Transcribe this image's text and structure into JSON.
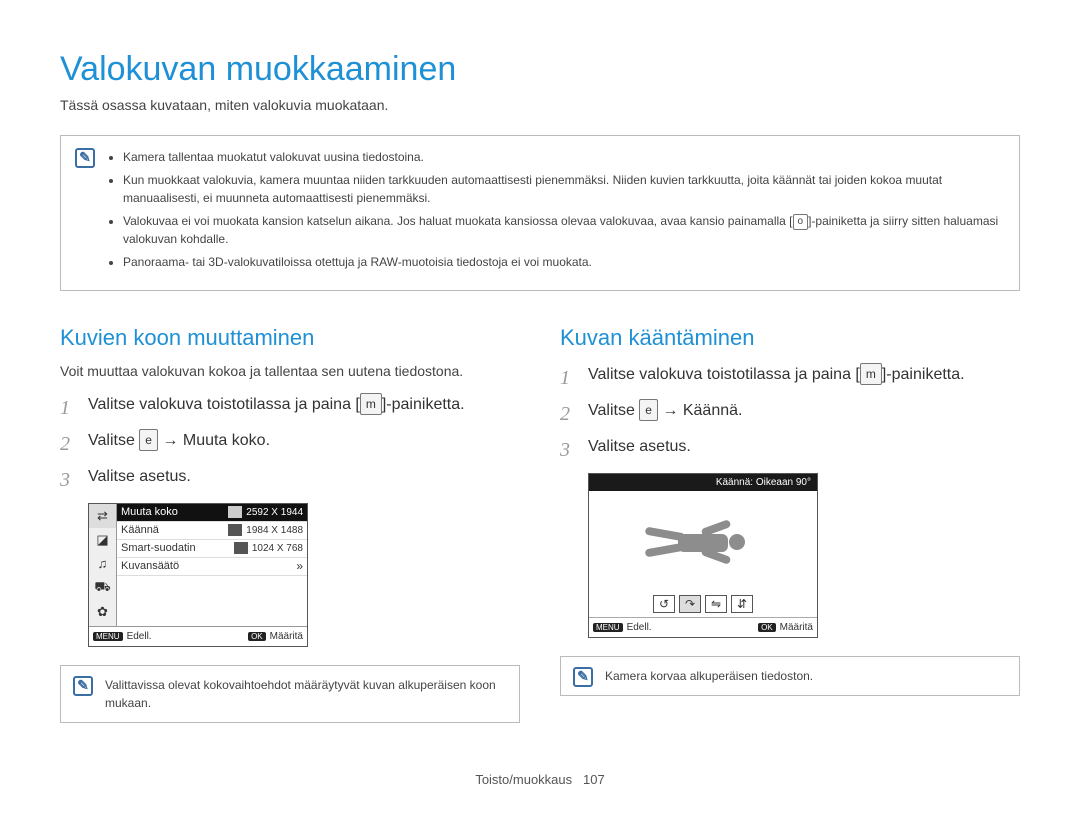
{
  "page": {
    "title": "Valokuvan muokkaaminen",
    "intro": "Tässä osassa kuvataan, miten valokuvia muokataan."
  },
  "top_info": {
    "bullets": [
      "Kamera tallentaa muokatut valokuvat uusina tiedostoina.",
      "Kun muokkaat valokuvia, kamera muuntaa niiden tarkkuuden automaattisesti pienemmäksi. Niiden kuvien tarkkuutta, joita käännät tai joiden kokoa muutat manuaalisesti, ei muunneta automaattisesti pienemmäksi.",
      "Valokuvaa ei voi muokata kansion katselun aikana. Jos haluat muokata kansiossa olevaa valokuvaa, avaa kansio painamalla [o]-painiketta ja siirry sitten haluamasi valokuvan kohdalle.",
      "Panoraama- tai 3D-valokuvatiloissa otettuja ja RAW-muotoisia tiedostoja ei voi muokata."
    ],
    "o_key": "o"
  },
  "left": {
    "title": "Kuvien koon muuttaminen",
    "desc": "Voit muuttaa valokuvan kokoa ja tallentaa sen uutena tiedostona.",
    "steps": [
      "Valitse valokuva toistotilassa ja paina [m]-painiketta.",
      "Valitse e → Muuta koko.",
      "Valitse asetus."
    ],
    "ui": {
      "menu_rows": [
        {
          "label": "Muuta koko",
          "value": "2592 X 1944",
          "black": true
        },
        {
          "label": "Käännä",
          "value": "1984 X 1488",
          "black": false
        },
        {
          "label": "Smart-suodatin",
          "value": "1024 X 768",
          "black": false
        },
        {
          "label": "Kuvansäätö",
          "value": "",
          "black": false,
          "chev": "»"
        }
      ],
      "footer_left_key": "MENU",
      "footer_left": "Edell.",
      "footer_right_key": "OK",
      "footer_right": "Määritä"
    },
    "note": "Valittavissa olevat kokovaihtoehdot määräytyvät kuvan alkuperäisen koon mukaan."
  },
  "right": {
    "title": "Kuvan kääntäminen",
    "steps": [
      "Valitse valokuva toistotilassa ja paina [m]-painiketta.",
      "Valitse e → Käännä.",
      "Valitse asetus."
    ],
    "panel": {
      "header": "Käännä: Oikeaan 90°",
      "footer_left_key": "MENU",
      "footer_left": "Edell.",
      "footer_right_key": "OK",
      "footer_right": "Määritä"
    },
    "note": "Kamera korvaa alkuperäisen tiedoston."
  },
  "footer": {
    "section": "Toisto/muokkaus",
    "page_number": "107"
  }
}
